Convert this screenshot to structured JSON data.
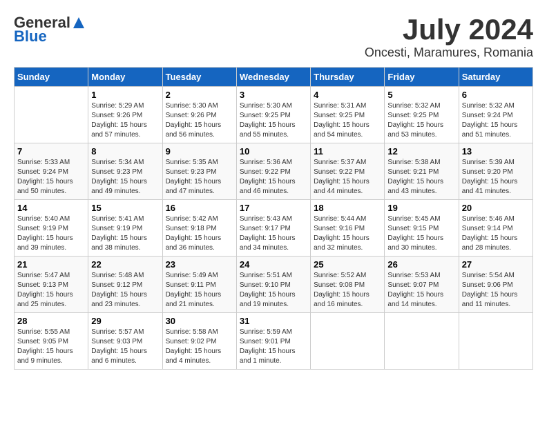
{
  "logo": {
    "general": "General",
    "blue": "Blue"
  },
  "title": "July 2024",
  "subtitle": "Oncesti, Maramures, Romania",
  "days_of_week": [
    "Sunday",
    "Monday",
    "Tuesday",
    "Wednesday",
    "Thursday",
    "Friday",
    "Saturday"
  ],
  "weeks": [
    [
      {
        "day": "",
        "info": ""
      },
      {
        "day": "1",
        "info": "Sunrise: 5:29 AM\nSunset: 9:26 PM\nDaylight: 15 hours\nand 57 minutes."
      },
      {
        "day": "2",
        "info": "Sunrise: 5:30 AM\nSunset: 9:26 PM\nDaylight: 15 hours\nand 56 minutes."
      },
      {
        "day": "3",
        "info": "Sunrise: 5:30 AM\nSunset: 9:25 PM\nDaylight: 15 hours\nand 55 minutes."
      },
      {
        "day": "4",
        "info": "Sunrise: 5:31 AM\nSunset: 9:25 PM\nDaylight: 15 hours\nand 54 minutes."
      },
      {
        "day": "5",
        "info": "Sunrise: 5:32 AM\nSunset: 9:25 PM\nDaylight: 15 hours\nand 53 minutes."
      },
      {
        "day": "6",
        "info": "Sunrise: 5:32 AM\nSunset: 9:24 PM\nDaylight: 15 hours\nand 51 minutes."
      }
    ],
    [
      {
        "day": "7",
        "info": "Sunrise: 5:33 AM\nSunset: 9:24 PM\nDaylight: 15 hours\nand 50 minutes."
      },
      {
        "day": "8",
        "info": "Sunrise: 5:34 AM\nSunset: 9:23 PM\nDaylight: 15 hours\nand 49 minutes."
      },
      {
        "day": "9",
        "info": "Sunrise: 5:35 AM\nSunset: 9:23 PM\nDaylight: 15 hours\nand 47 minutes."
      },
      {
        "day": "10",
        "info": "Sunrise: 5:36 AM\nSunset: 9:22 PM\nDaylight: 15 hours\nand 46 minutes."
      },
      {
        "day": "11",
        "info": "Sunrise: 5:37 AM\nSunset: 9:22 PM\nDaylight: 15 hours\nand 44 minutes."
      },
      {
        "day": "12",
        "info": "Sunrise: 5:38 AM\nSunset: 9:21 PM\nDaylight: 15 hours\nand 43 minutes."
      },
      {
        "day": "13",
        "info": "Sunrise: 5:39 AM\nSunset: 9:20 PM\nDaylight: 15 hours\nand 41 minutes."
      }
    ],
    [
      {
        "day": "14",
        "info": "Sunrise: 5:40 AM\nSunset: 9:19 PM\nDaylight: 15 hours\nand 39 minutes."
      },
      {
        "day": "15",
        "info": "Sunrise: 5:41 AM\nSunset: 9:19 PM\nDaylight: 15 hours\nand 38 minutes."
      },
      {
        "day": "16",
        "info": "Sunrise: 5:42 AM\nSunset: 9:18 PM\nDaylight: 15 hours\nand 36 minutes."
      },
      {
        "day": "17",
        "info": "Sunrise: 5:43 AM\nSunset: 9:17 PM\nDaylight: 15 hours\nand 34 minutes."
      },
      {
        "day": "18",
        "info": "Sunrise: 5:44 AM\nSunset: 9:16 PM\nDaylight: 15 hours\nand 32 minutes."
      },
      {
        "day": "19",
        "info": "Sunrise: 5:45 AM\nSunset: 9:15 PM\nDaylight: 15 hours\nand 30 minutes."
      },
      {
        "day": "20",
        "info": "Sunrise: 5:46 AM\nSunset: 9:14 PM\nDaylight: 15 hours\nand 28 minutes."
      }
    ],
    [
      {
        "day": "21",
        "info": "Sunrise: 5:47 AM\nSunset: 9:13 PM\nDaylight: 15 hours\nand 25 minutes."
      },
      {
        "day": "22",
        "info": "Sunrise: 5:48 AM\nSunset: 9:12 PM\nDaylight: 15 hours\nand 23 minutes."
      },
      {
        "day": "23",
        "info": "Sunrise: 5:49 AM\nSunset: 9:11 PM\nDaylight: 15 hours\nand 21 minutes."
      },
      {
        "day": "24",
        "info": "Sunrise: 5:51 AM\nSunset: 9:10 PM\nDaylight: 15 hours\nand 19 minutes."
      },
      {
        "day": "25",
        "info": "Sunrise: 5:52 AM\nSunset: 9:08 PM\nDaylight: 15 hours\nand 16 minutes."
      },
      {
        "day": "26",
        "info": "Sunrise: 5:53 AM\nSunset: 9:07 PM\nDaylight: 15 hours\nand 14 minutes."
      },
      {
        "day": "27",
        "info": "Sunrise: 5:54 AM\nSunset: 9:06 PM\nDaylight: 15 hours\nand 11 minutes."
      }
    ],
    [
      {
        "day": "28",
        "info": "Sunrise: 5:55 AM\nSunset: 9:05 PM\nDaylight: 15 hours\nand 9 minutes."
      },
      {
        "day": "29",
        "info": "Sunrise: 5:57 AM\nSunset: 9:03 PM\nDaylight: 15 hours\nand 6 minutes."
      },
      {
        "day": "30",
        "info": "Sunrise: 5:58 AM\nSunset: 9:02 PM\nDaylight: 15 hours\nand 4 minutes."
      },
      {
        "day": "31",
        "info": "Sunrise: 5:59 AM\nSunset: 9:01 PM\nDaylight: 15 hours\nand 1 minute."
      },
      {
        "day": "",
        "info": ""
      },
      {
        "day": "",
        "info": ""
      },
      {
        "day": "",
        "info": ""
      }
    ]
  ]
}
